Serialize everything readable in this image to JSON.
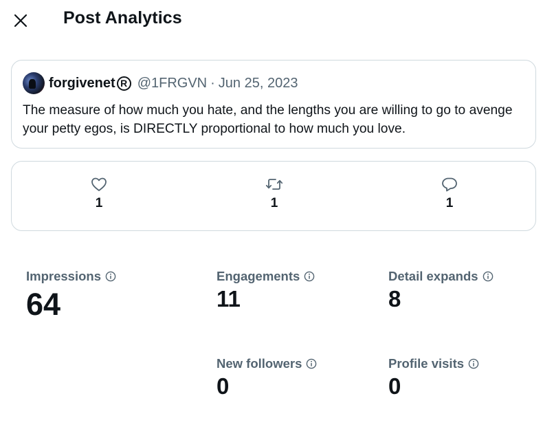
{
  "header": {
    "title": "Post Analytics",
    "close_icon": "close-icon"
  },
  "post": {
    "display_name": "forgivenet",
    "badge": "R",
    "handle": "@1FRGVN",
    "separator": "·",
    "date": "Jun 25, 2023",
    "text": "The measure of how much you hate, and the lengths you are willing to go to avenge your petty egos, is DIRECTLY proportional to how much you love."
  },
  "interactions": {
    "likes": "1",
    "reposts": "1",
    "replies": "1"
  },
  "stats": {
    "impressions": {
      "label": "Impressions",
      "value": "64"
    },
    "engagements": {
      "label": "Engagements",
      "value": "11"
    },
    "detail_expands": {
      "label": "Detail expands",
      "value": "8"
    },
    "new_followers": {
      "label": "New followers",
      "value": "0"
    },
    "profile_visits": {
      "label": "Profile visits",
      "value": "0"
    }
  },
  "colors": {
    "text": "#0f1419",
    "secondary": "#536471",
    "border": "#cfd9de"
  }
}
